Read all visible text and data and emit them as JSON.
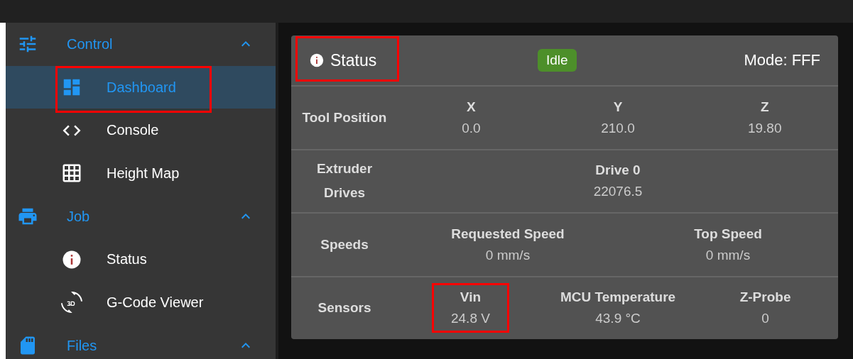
{
  "sidebar": {
    "groups": [
      {
        "label": "Control",
        "expanded": true,
        "items": [
          {
            "label": "Dashboard",
            "selected": true,
            "highlighted": true
          },
          {
            "label": "Console",
            "selected": false,
            "highlighted": false
          },
          {
            "label": "Height Map",
            "selected": false,
            "highlighted": false
          }
        ]
      },
      {
        "label": "Job",
        "expanded": true,
        "items": [
          {
            "label": "Status",
            "selected": false,
            "highlighted": false
          },
          {
            "label": "G-Code Viewer",
            "selected": false,
            "highlighted": false
          }
        ]
      },
      {
        "label": "Files",
        "expanded": true
      }
    ]
  },
  "status_card": {
    "title": "Status",
    "title_highlighted": true,
    "state_badge": "Idle",
    "mode": "Mode: FFF",
    "sections": [
      {
        "label": "Tool Position",
        "fields": [
          {
            "name": "X",
            "value": "0.0",
            "highlighted": false
          },
          {
            "name": "Y",
            "value": "210.0",
            "highlighted": false
          },
          {
            "name": "Z",
            "value": "19.80",
            "highlighted": false
          }
        ]
      },
      {
        "label": "Extruder Drives",
        "fields": [
          {
            "name": "Drive 0",
            "value": "22076.5",
            "highlighted": false
          }
        ]
      },
      {
        "label": "Speeds",
        "fields": [
          {
            "name": "Requested Speed",
            "value": "0 mm/s",
            "highlighted": false
          },
          {
            "name": "Top Speed",
            "value": "0 mm/s",
            "highlighted": false
          }
        ]
      },
      {
        "label": "Sensors",
        "fields": [
          {
            "name": "Vin",
            "value": "24.8 V",
            "highlighted": true
          },
          {
            "name": "MCU Temperature",
            "value": "43.9 °C",
            "highlighted": false
          },
          {
            "name": "Z-Probe",
            "value": "0",
            "highlighted": false
          }
        ]
      }
    ]
  }
}
